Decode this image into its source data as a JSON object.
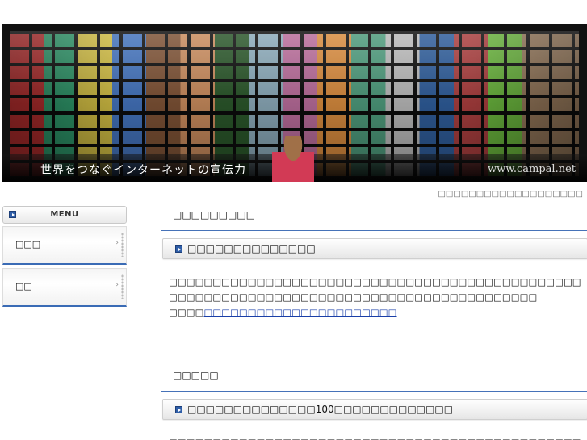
{
  "banner": {
    "tagline": "世界をつなぐインターネットの宣伝力",
    "url": "www.campal.net"
  },
  "top_caption": "□□□□□□□□□□□□□□□□□□□",
  "sidebar": {
    "menu_title": "MENU",
    "items": [
      {
        "label": "□□□"
      },
      {
        "label": "□□"
      }
    ]
  },
  "main": {
    "sections": [
      {
        "heading": "□□□□□□□□□",
        "article_title": "□□□□□□□□□□□□□□",
        "body": "□□□□□□□□□□□□□□□□□□□□□□□□□□□□□□□□□□□□□□□□□□□□□□□□□□□□□□□□□□□□□□□□□□□□□□□□□□□□□□□□□□□□□□□□□",
        "source_prefix": "□□□□",
        "source_link": "□□□□□□□□□□□□□□□□□□□□□□"
      },
      {
        "heading": "□□□□□",
        "article_title": "□□□□□□□□□□□□□□100□□□□□□□□□□□□□",
        "body": "□□□□□□□□□□□□□□□□□□□□□□□□□□□□□□□□□□□□□□□□□□□□□□□□"
      }
    ]
  }
}
